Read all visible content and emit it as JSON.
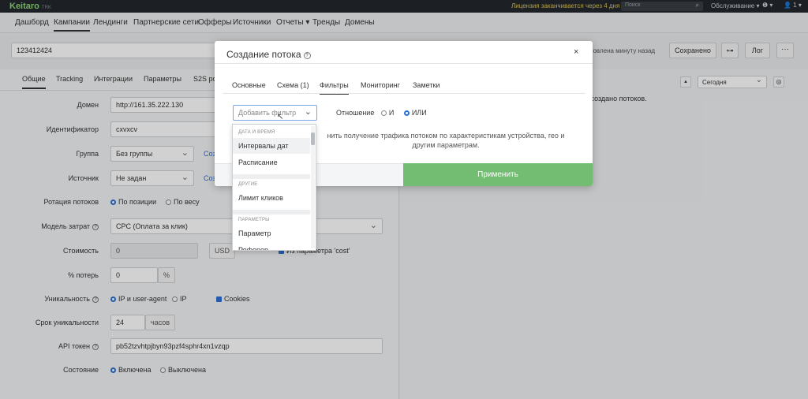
{
  "topbar": {
    "logo": "Keitaro",
    "logo_tm": "TRK",
    "license": "Лицензия заканчивается через 4 дня",
    "search_placeholder": "Поиск",
    "search_icon": "search-icon",
    "service": "Обслуживание ▾",
    "help": "❶ ▾",
    "user": "👤 1 ▾"
  },
  "nav": {
    "items": [
      "Дашборд",
      "Кампании",
      "Лендинги",
      "Партнерские сети",
      "Офферы",
      "Источники",
      "Отчеты ▾",
      "Тренды",
      "Домены"
    ],
    "active_index": 1
  },
  "campaign": {
    "name": "123412424",
    "updated": "обновлена минуту назад",
    "saved": "Сохранено",
    "link_icon": "link-icon",
    "log": "Лог",
    "more": "···"
  },
  "campaign_tabs": {
    "items": [
      "Общие",
      "Tracking",
      "Интеграции",
      "Параметры",
      "S2S ро"
    ],
    "active_index": 0
  },
  "form": {
    "domain_label": "Домен",
    "domain_value": "http://161.35.222.130",
    "id_label": "Идентификатор",
    "id_value": "cxvxcv",
    "group_label": "Группа",
    "group_value": "Без группы",
    "group_link": "Соз",
    "source_label": "Источник",
    "source_value": "Не задан",
    "source_link": "Соз",
    "rotation_label": "Ротация потоков",
    "rotation_opt1": "По позиции",
    "rotation_opt2": "По весу",
    "cost_model_label": "Модель затрат",
    "cost_model_value": "CPC (Оплата за клик)",
    "cost_label": "Стоимость",
    "cost_value": "0",
    "cost_currency": "USD",
    "cost_from_param": "Из параметра 'cost'",
    "loss_label": "% потерь",
    "loss_value": "0",
    "loss_unit": "%",
    "unique_label": "Уникальность",
    "unique_opt1": "IP и user-agent",
    "unique_opt2": "IP",
    "unique_cookies": "Cookies",
    "unique_term_label": "Срок уникальности",
    "unique_term_value": "24",
    "unique_term_unit": "часов",
    "api_label": "API токен",
    "api_value": "pb52tzvhtpjbyn93pzf4sphr4xn1vzqp",
    "state_label": "Состояние",
    "state_opt1": "Включена",
    "state_opt2": "Выключена"
  },
  "right": {
    "period": "Сегодня",
    "no_flows": "не создано потоков."
  },
  "modal": {
    "title": "Создание потока",
    "close": "×",
    "tabs": [
      "Основные",
      "Схема (1)",
      "Фильтры",
      "Мониторинг",
      "Заметки"
    ],
    "active_tab_index": 2,
    "add_filter_placeholder": "Добавить фильтр",
    "relation_label": "Отношение",
    "relation_and": "И",
    "relation_or": "ИЛИ",
    "hint": "нить получение трафика потоком по характеристикам устройства, гео и другим параметрам.",
    "cancel_partial": "а",
    "apply": "Применить"
  },
  "dropdown": {
    "group1": "ДАТА И ВРЕМЯ",
    "item1": "Интервалы дат",
    "item2": "Расписание",
    "group2": "ДРУГИЕ",
    "item3": "Лимит кликов",
    "group3": "ПАРАМЕТРЫ",
    "item4": "Параметр",
    "item5": "Реферер"
  },
  "colors": {
    "accent_green": "#73bd72",
    "link_blue": "#2a6fd6",
    "logo_green": "#8cd77b"
  }
}
